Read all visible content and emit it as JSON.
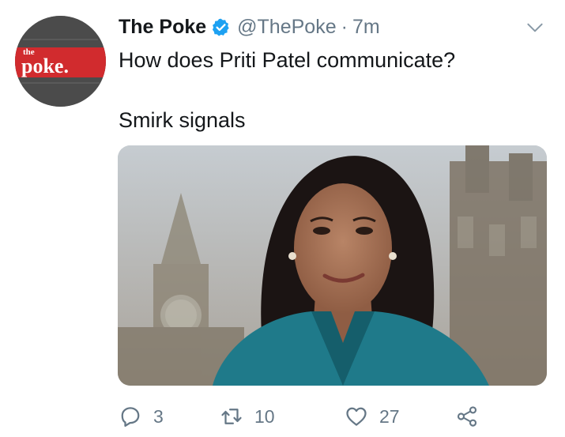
{
  "tweet": {
    "avatar": {
      "logo_small": "the",
      "logo_big": "poke."
    },
    "author_name": "The Poke",
    "handle": "@ThePoke",
    "separator": "·",
    "timestamp": "7m",
    "text": "How does Priti Patel communicate?\n\nSmirk signals",
    "media": {
      "kind": "photo"
    },
    "actions": {
      "reply": {
        "icon": "reply-icon",
        "count": "3"
      },
      "retweet": {
        "icon": "retweet-icon",
        "count": "10"
      },
      "like": {
        "icon": "heart-icon",
        "count": "27"
      },
      "share": {
        "icon": "share-icon"
      }
    }
  },
  "colors": {
    "text": "#14171a",
    "secondary": "#657786",
    "verified": "#1da1f2",
    "logo_red": "#d12b2e"
  }
}
